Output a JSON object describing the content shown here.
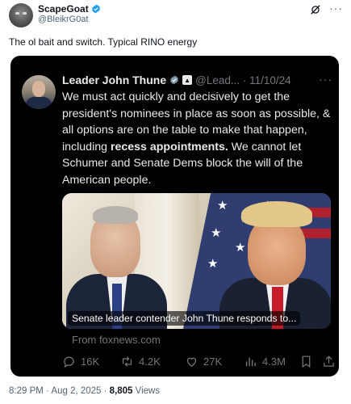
{
  "post": {
    "author_name": "ScapeGoat",
    "author_handle": "@BleikrG0at",
    "text": "The ol bait and switch. Typical RINO energy",
    "timestamp": "8:29 PM · Aug 2, 2025 · ",
    "views_count": "8,805",
    "views_label": " Views"
  },
  "quoted": {
    "author_name": "Leader John Thune",
    "meta": "@Lead... · 11/10/24",
    "text_before": "We must act quickly and decisively to get the president's nominees in place as soon as possible, & all options are on the table to make that happen, including ",
    "text_bold": "recess appointments.",
    "text_after": " We cannot let Schumer and Senate Dems block the will of the American people.",
    "media_caption": "Senate leader contender John Thune responds to...",
    "source": "From foxnews.com",
    "actions": {
      "replies": "16K",
      "reposts": "4.2K",
      "likes": "27K",
      "views": "4.3M"
    }
  },
  "colors": {
    "verified_blue": "#1d9bf0",
    "card_bg": "#000000",
    "muted": "#71767b"
  },
  "icons": [
    "verified-badge-icon",
    "grok-icon",
    "more-icon",
    "government-badge-icon",
    "reply-icon",
    "repost-icon",
    "like-icon",
    "views-icon",
    "bookmark-icon",
    "share-icon"
  ]
}
